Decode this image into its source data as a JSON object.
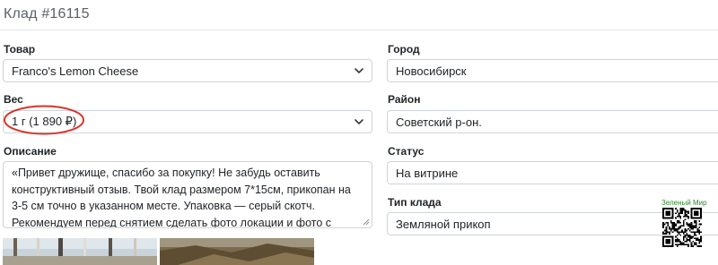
{
  "header": {
    "title": "Клад #16115"
  },
  "form": {
    "product": {
      "label": "Товар",
      "value": "Franco's Lemon Cheese"
    },
    "weight": {
      "label": "Вес",
      "value": "1 г (1 890 ₽)"
    },
    "description": {
      "label": "Описание",
      "lines": [
        "«Привет дружище, спасибо за покупку! Не забудь оставить",
        "конструктивный отзыв. Твой клад размером 7*15см, прикопан на",
        "3-5 см точно в указанном месте. Упаковка — серый скотч.",
        "Рекомендуем перед снятием сделать фото локации и фото с"
      ]
    },
    "city": {
      "label": "Город",
      "value": "Новосибирск"
    },
    "district": {
      "label": "Район",
      "value": "Советский р-он."
    },
    "status": {
      "label": "Статус",
      "value": "На витрине"
    },
    "cache_type": {
      "label": "Тип клада",
      "value": "Земляной прикоп"
    }
  },
  "qr": {
    "caption": "Зеленый Мир"
  },
  "colors": {
    "annotation": "#d9342b",
    "qr_caption": "#2c8a2c"
  }
}
